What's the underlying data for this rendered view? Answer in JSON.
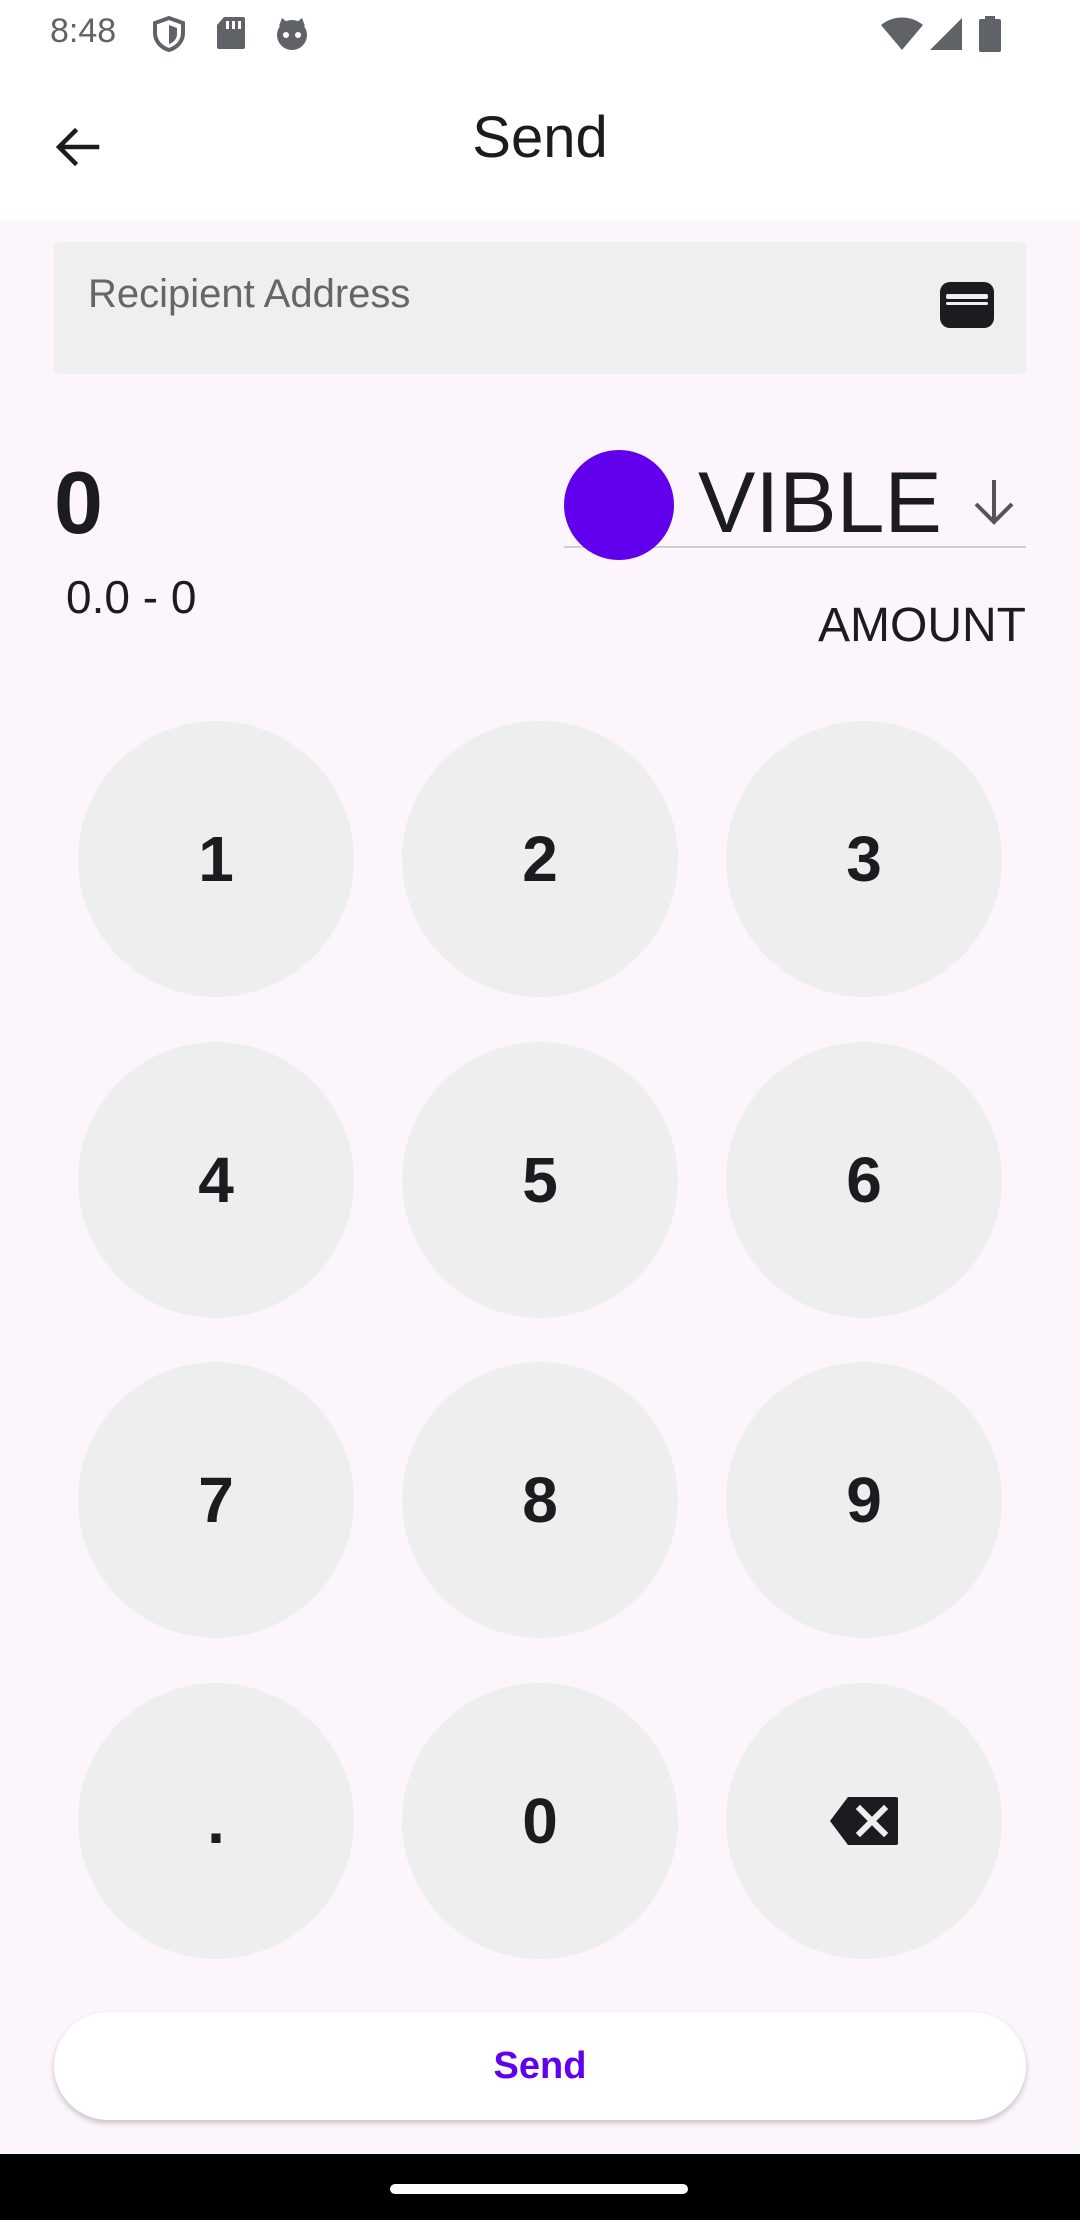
{
  "status_bar": {
    "time": "8:48",
    "icons": [
      "shield-icon",
      "sd-card-icon",
      "cat-face-icon",
      "wifi-icon",
      "cell-signal-icon",
      "battery-icon"
    ]
  },
  "app_bar": {
    "title": "Send",
    "back_icon": "arrow-left-icon"
  },
  "recipient": {
    "placeholder": "Recipient Address",
    "icon": "wallet-icon"
  },
  "amount": {
    "value": "0",
    "range": "0.0 - 0",
    "label": "AMOUNT"
  },
  "token": {
    "name": "VIBLE",
    "color": "#6200ee",
    "dropdown_icon": "arrow-down-icon"
  },
  "keypad": {
    "keys": [
      "1",
      "2",
      "3",
      "4",
      "5",
      "6",
      "7",
      "8",
      "9",
      ".",
      "0"
    ],
    "backspace_icon": "backspace-icon"
  },
  "send_button": {
    "label": "Send",
    "color": "#6200ee"
  }
}
